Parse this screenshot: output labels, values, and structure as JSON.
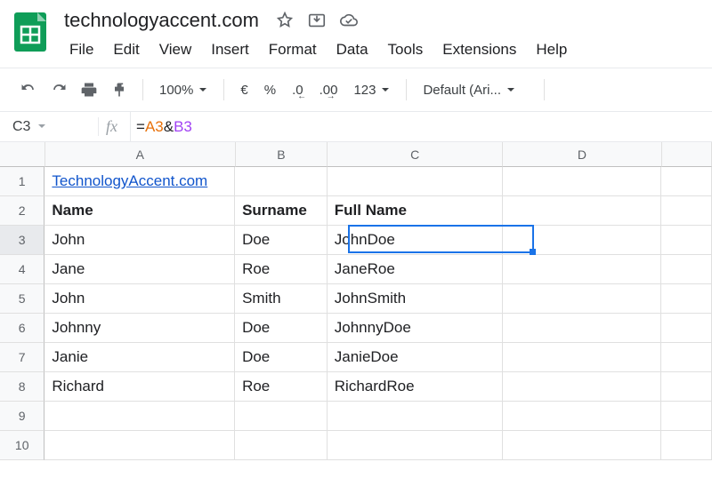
{
  "doc_title": "technologyaccent.com",
  "menus": [
    "File",
    "Edit",
    "View",
    "Insert",
    "Format",
    "Data",
    "Tools",
    "Extensions",
    "Help"
  ],
  "toolbar": {
    "zoom": "100%",
    "currency": "€",
    "percent": "%",
    "dec_dec": ".0",
    "inc_dec": ".00",
    "num_format": "123",
    "font": "Default (Ari..."
  },
  "namebox": "C3",
  "formula_prefix": "=",
  "formula_refA": "A3",
  "formula_amp": "&",
  "formula_refB": "B3",
  "columns": [
    "A",
    "B",
    "C",
    "D"
  ],
  "rows": [
    {
      "n": "1",
      "a": "TechnologyAccent.com",
      "b": "",
      "c": "",
      "link": true
    },
    {
      "n": "2",
      "a": "Name",
      "b": "Surname",
      "c": "Full Name",
      "bold": true
    },
    {
      "n": "3",
      "a": "John",
      "b": "Doe",
      "c": "JohnDoe"
    },
    {
      "n": "4",
      "a": "Jane",
      "b": "Roe",
      "c": "JaneRoe"
    },
    {
      "n": "5",
      "a": "John",
      "b": "Smith",
      "c": "JohnSmith"
    },
    {
      "n": "6",
      "a": "Johnny",
      "b": "Doe",
      "c": "JohnnyDoe"
    },
    {
      "n": "7",
      "a": "Janie",
      "b": "Doe",
      "c": "JanieDoe"
    },
    {
      "n": "8",
      "a": "Richard",
      "b": "Roe",
      "c": "RichardRoe"
    },
    {
      "n": "9",
      "a": "",
      "b": "",
      "c": ""
    },
    {
      "n": "10",
      "a": "",
      "b": "",
      "c": ""
    }
  ],
  "selected": {
    "row": 3,
    "col": "C"
  }
}
